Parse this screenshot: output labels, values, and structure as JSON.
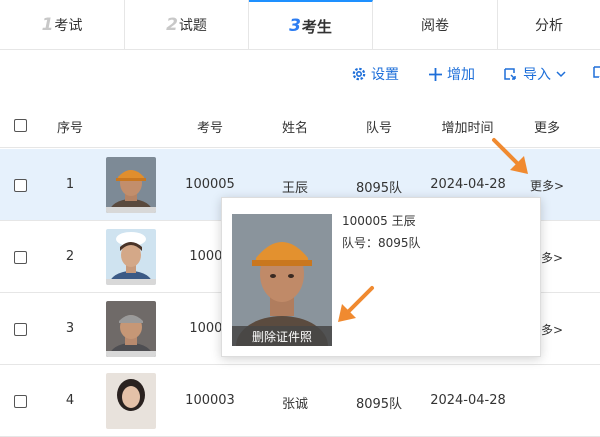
{
  "tabs": [
    {
      "num": "1",
      "label": "考试"
    },
    {
      "num": "2",
      "label": "试题"
    },
    {
      "num": "3",
      "label": "考生"
    },
    {
      "num": "",
      "label": "阅卷"
    },
    {
      "num": "",
      "label": "分析"
    }
  ],
  "toolbar": {
    "settings": "设置",
    "add": "增加",
    "import": "导入"
  },
  "table": {
    "headers": {
      "index": "序号",
      "exam_no": "考号",
      "name": "姓名",
      "team": "队号",
      "added": "增加时间",
      "more": "更多"
    },
    "rows": [
      {
        "index": "1",
        "exam_no": "100005",
        "name": "王辰",
        "team": "8095队",
        "added": "2024-04-28",
        "more": "更多>"
      },
      {
        "index": "2",
        "exam_no": "10000",
        "name": "",
        "team": "",
        "added": "",
        "more": "多>"
      },
      {
        "index": "3",
        "exam_no": "10000",
        "name": "",
        "team": "",
        "added": "",
        "more": "多>"
      },
      {
        "index": "4",
        "exam_no": "100003",
        "name": "张诚",
        "team": "8095队",
        "added": "2024-04-28",
        "more": ""
      }
    ]
  },
  "popup": {
    "line1": "100005 王辰",
    "line2": "队号：8095队",
    "delete_label": "删除证件照"
  },
  "colors": {
    "accent": "#1e6fd9",
    "highlight_row": "#e6f1fc",
    "arrow": "#f08a30"
  }
}
